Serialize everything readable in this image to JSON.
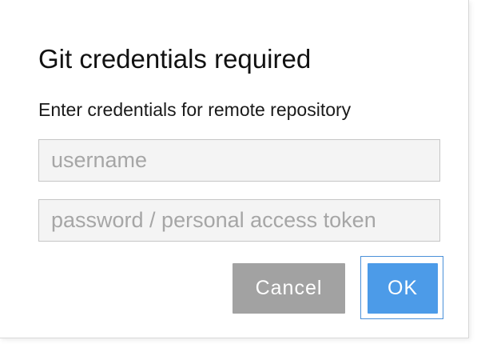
{
  "dialog": {
    "title": "Git credentials required",
    "subtitle": "Enter credentials for remote repository",
    "username": {
      "value": "",
      "placeholder": "username"
    },
    "password": {
      "value": "",
      "placeholder": "password / personal access token"
    },
    "buttons": {
      "cancel_label": "Cancel",
      "ok_label": "OK"
    }
  },
  "colors": {
    "primary": "#4c9be8",
    "secondary": "#a2a2a2",
    "focus_ring": "#4a90d9"
  }
}
